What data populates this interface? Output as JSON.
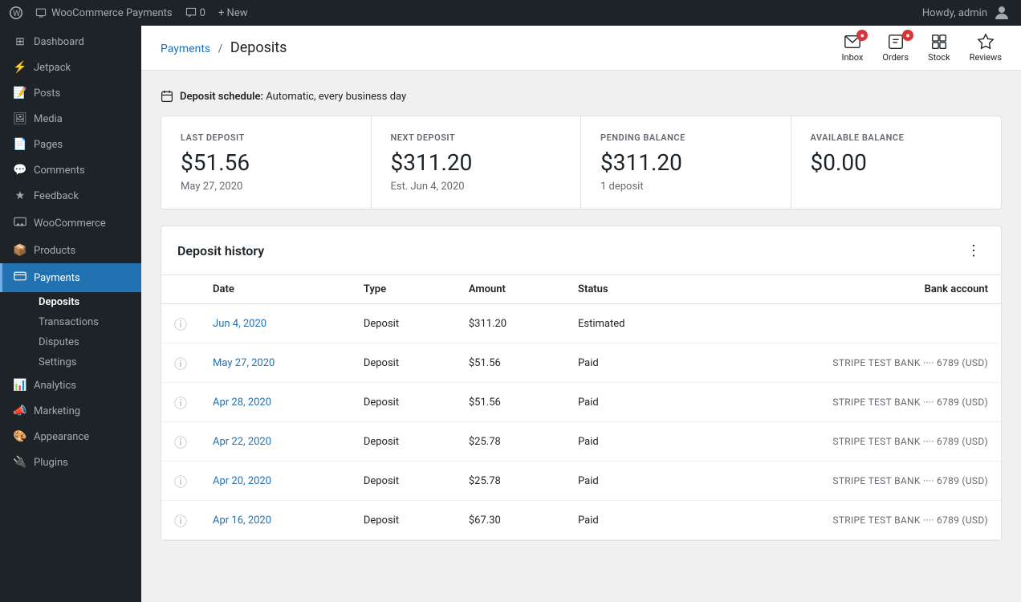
{
  "topbar": {
    "logo_icon": "wp-icon",
    "site_name": "WooCommerce Payments",
    "comments_icon": "comments-icon",
    "comments_count": "0",
    "new_label": "+ New",
    "howdy": "Howdy, admin",
    "avatar_icon": "avatar-icon"
  },
  "sidebar": {
    "items": [
      {
        "id": "dashboard",
        "label": "Dashboard",
        "icon": "dashboard-icon"
      },
      {
        "id": "jetpack",
        "label": "Jetpack",
        "icon": "jetpack-icon"
      },
      {
        "id": "posts",
        "label": "Posts",
        "icon": "posts-icon"
      },
      {
        "id": "media",
        "label": "Media",
        "icon": "media-icon"
      },
      {
        "id": "pages",
        "label": "Pages",
        "icon": "pages-icon"
      },
      {
        "id": "comments",
        "label": "Comments",
        "icon": "comments-icon"
      },
      {
        "id": "feedback",
        "label": "Feedback",
        "icon": "feedback-icon"
      },
      {
        "id": "woocommerce",
        "label": "WooCommerce",
        "icon": "woo-icon"
      },
      {
        "id": "products",
        "label": "Products",
        "icon": "products-icon"
      },
      {
        "id": "payments",
        "label": "Payments",
        "icon": "payments-icon",
        "active": true
      }
    ],
    "payments_submenu": [
      {
        "id": "deposits",
        "label": "Deposits",
        "active": true
      },
      {
        "id": "transactions",
        "label": "Transactions"
      },
      {
        "id": "disputes",
        "label": "Disputes"
      },
      {
        "id": "settings",
        "label": "Settings"
      }
    ],
    "bottom_items": [
      {
        "id": "analytics",
        "label": "Analytics",
        "icon": "analytics-icon"
      },
      {
        "id": "marketing",
        "label": "Marketing",
        "icon": "marketing-icon"
      },
      {
        "id": "appearance",
        "label": "Appearance",
        "icon": "appearance-icon"
      },
      {
        "id": "plugins",
        "label": "Plugins",
        "icon": "plugins-icon"
      }
    ]
  },
  "header": {
    "breadcrumb_link": "Payments",
    "breadcrumb_sep": "/",
    "breadcrumb_current": "Deposits",
    "toolbar": [
      {
        "id": "inbox",
        "label": "Inbox",
        "has_badge": true,
        "badge_count": ""
      },
      {
        "id": "orders",
        "label": "Orders",
        "has_badge": true,
        "badge_count": ""
      },
      {
        "id": "stock",
        "label": "Stock",
        "has_badge": false
      },
      {
        "id": "reviews",
        "label": "Reviews",
        "has_badge": false
      }
    ]
  },
  "deposit_schedule": {
    "icon": "calendar-icon",
    "label": "Deposit schedule:",
    "value": "Automatic, every business day"
  },
  "stats": [
    {
      "label": "LAST DEPOSIT",
      "value": "$51.56",
      "sub": "May 27, 2020"
    },
    {
      "label": "NEXT DEPOSIT",
      "value": "$311.20",
      "sub": "Est. Jun 4, 2020"
    },
    {
      "label": "PENDING BALANCE",
      "value": "$311.20",
      "sub": "1 deposit"
    },
    {
      "label": "AVAILABLE BALANCE",
      "value": "$0.00",
      "sub": ""
    }
  ],
  "deposit_history": {
    "title": "Deposit history",
    "columns": [
      "Date",
      "Type",
      "Amount",
      "Status",
      "Bank account"
    ],
    "rows": [
      {
        "date": "Jun 4, 2020",
        "type": "Deposit",
        "amount": "$311.20",
        "status": "Estimated",
        "bank": ""
      },
      {
        "date": "May 27, 2020",
        "type": "Deposit",
        "amount": "$51.56",
        "status": "Paid",
        "bank": "STRIPE TEST BANK ···· 6789 (USD)"
      },
      {
        "date": "Apr 28, 2020",
        "type": "Deposit",
        "amount": "$51.56",
        "status": "Paid",
        "bank": "STRIPE TEST BANK ···· 6789 (USD)"
      },
      {
        "date": "Apr 22, 2020",
        "type": "Deposit",
        "amount": "$25.78",
        "status": "Paid",
        "bank": "STRIPE TEST BANK ···· 6789 (USD)"
      },
      {
        "date": "Apr 20, 2020",
        "type": "Deposit",
        "amount": "$25.78",
        "status": "Paid",
        "bank": "STRIPE TEST BANK ···· 6789 (USD)"
      },
      {
        "date": "Apr 16, 2020",
        "type": "Deposit",
        "amount": "$67.30",
        "status": "Paid",
        "bank": "STRIPE TEST BANK ···· 6789 (USD)"
      }
    ]
  }
}
